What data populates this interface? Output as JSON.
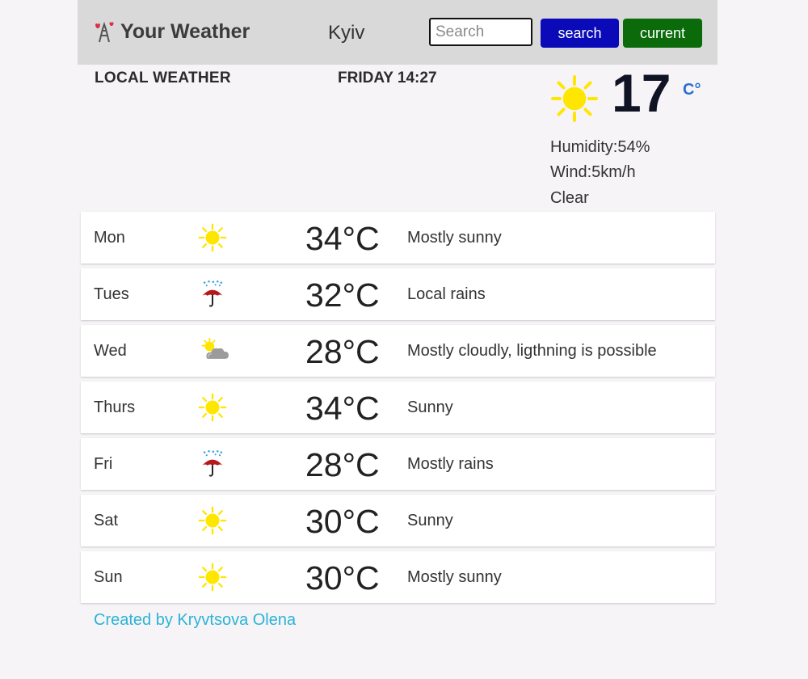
{
  "header": {
    "brand": "Your Weather",
    "city": "Kyiv",
    "search_placeholder": "Search",
    "search_label": "search",
    "current_label": "current"
  },
  "colors": {
    "header_bg": "#d9d9d9",
    "search_button": "#0a0ab8",
    "current_button": "#0b6b0b",
    "footer_link": "#2bb3d6",
    "unit": "#2a6fd2",
    "sun": "#ffe600"
  },
  "local": {
    "label": "LOCAL WEATHER",
    "datetime": "FRIDAY 14:27"
  },
  "current": {
    "icon": "sun-icon",
    "temp": "17",
    "unit": "C°",
    "humidity": "Humidity:54%",
    "wind": "Wind:5km/h",
    "condition": "Clear"
  },
  "forecast": [
    {
      "day": "Mon",
      "icon": "sun-icon",
      "temp": "34°C",
      "desc": "Mostly sunny"
    },
    {
      "day": "Tues",
      "icon": "umbrella-rain-icon",
      "temp": "32°C",
      "desc": "Local rains"
    },
    {
      "day": "Wed",
      "icon": "partly-cloudy-icon",
      "temp": "28°C",
      "desc": "Mostly cloudly, ligthning is possible"
    },
    {
      "day": "Thurs",
      "icon": "sun-icon",
      "temp": "34°C",
      "desc": "Sunny"
    },
    {
      "day": "Fri",
      "icon": "umbrella-rain-icon",
      "temp": "28°C",
      "desc": "Mostly rains"
    },
    {
      "day": "Sat",
      "icon": "sun-icon",
      "temp": "30°C",
      "desc": "Sunny"
    },
    {
      "day": "Sun",
      "icon": "sun-icon",
      "temp": "30°C",
      "desc": "Mostly sunny"
    }
  ],
  "footer": {
    "credit": "Created by Kryvtsova Olena"
  }
}
